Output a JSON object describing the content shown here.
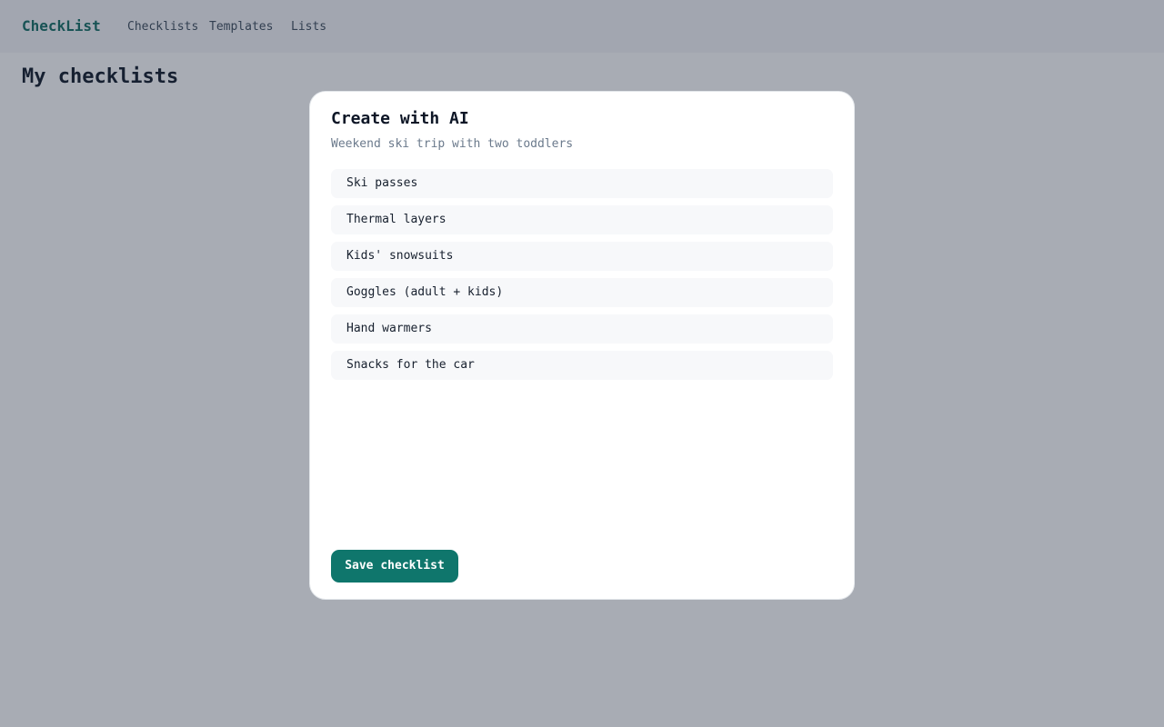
{
  "header": {
    "brand": "CheckList",
    "nav": [
      "Checklists",
      "Templates",
      "Lists"
    ]
  },
  "page": {
    "title": "My checklists"
  },
  "modal": {
    "title": "Create with AI",
    "prompt": "Weekend ski trip with two toddlers",
    "items": [
      "Ski passes",
      "Thermal layers",
      "Kids' snowsuits",
      "Goggles (adult + kids)",
      "Hand warmers",
      "Snacks for the car"
    ],
    "save_label": "Save checklist"
  },
  "colors": {
    "accent": "#0f766c",
    "brand": "#0f6b62",
    "overlay": "rgba(38,48,68,0.40)"
  }
}
